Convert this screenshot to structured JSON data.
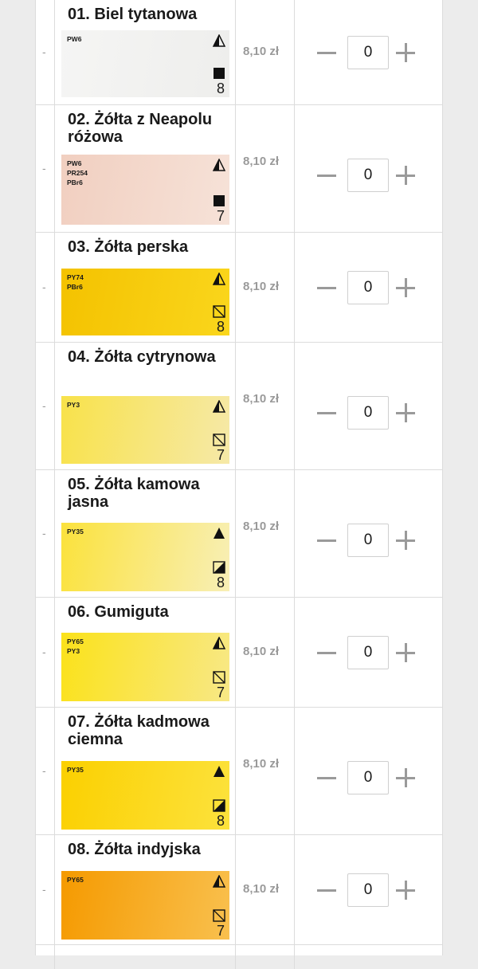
{
  "colors": {
    "price": "#9a9a9a",
    "border": "#dcdcdc",
    "stepper": "#9a9a9a"
  },
  "rows": [
    {
      "dash": "-",
      "name": "01. Biel tytanowa",
      "pigments": [
        "PW6"
      ],
      "transparency": "semi",
      "lightfastness": "full",
      "lightfastness_value": "8",
      "price": "8,10 zł",
      "quantity": "0",
      "swatch_colors": [
        "#f5f5f4",
        "#eeeeec"
      ]
    },
    {
      "dash": "-",
      "name": "02. Żółta z Neapolu różowa",
      "pigments": [
        "PW6",
        "PR254",
        "PBr6"
      ],
      "transparency": "semi",
      "lightfastness": "full",
      "lightfastness_value": "7",
      "price": "8,10 zł",
      "quantity": "0",
      "swatch_colors": [
        "#f1cfc0",
        "#f6e2d8"
      ]
    },
    {
      "dash": "-",
      "name": "03. Żółta perska",
      "pigments": [
        "PY74",
        "PBr6"
      ],
      "transparency": "semi",
      "lightfastness": "hatch",
      "lightfastness_value": "8",
      "price": "8,10 zł",
      "quantity": "0",
      "swatch_colors": [
        "#f4c200",
        "#fad61c"
      ]
    },
    {
      "dash": "-",
      "name": "04. Żółta cytrynowa",
      "pigments": [
        "PY3"
      ],
      "transparency": "semi",
      "lightfastness": "hatch",
      "lightfastness_value": "7",
      "price": "8,10 zł",
      "quantity": "0",
      "swatch_colors": [
        "#f8e24a",
        "#f6e9a8"
      ]
    },
    {
      "dash": "-",
      "name": "05. Żółta kamowa jasna",
      "pigments": [
        "PY35"
      ],
      "transparency": "full",
      "lightfastness": "half",
      "lightfastness_value": "8",
      "price": "8,10 zł",
      "quantity": "0",
      "swatch_colors": [
        "#fbe23c",
        "#f8efb6"
      ]
    },
    {
      "dash": "-",
      "name": "06. Gumiguta",
      "pigments": [
        "PY65",
        "PY3"
      ],
      "transparency": "semi",
      "lightfastness": "hatch",
      "lightfastness_value": "7",
      "price": "8,10 zł",
      "quantity": "0",
      "swatch_colors": [
        "#fbe21a",
        "#f8e886"
      ]
    },
    {
      "dash": "-",
      "name": "07. Żółta kadmowa ciemna",
      "pigments": [
        "PY35"
      ],
      "transparency": "full",
      "lightfastness": "half",
      "lightfastness_value": "8",
      "price": "8,10 zł",
      "quantity": "0",
      "swatch_colors": [
        "#fbd000",
        "#fce23c"
      ]
    },
    {
      "dash": "-",
      "name": "08. Żółta indyjska",
      "pigments": [
        "PY65"
      ],
      "transparency": "semi",
      "lightfastness": "hatch",
      "lightfastness_value": "7",
      "price": "8,10 zł",
      "quantity": "0",
      "swatch_colors": [
        "#f59a00",
        "#f9c04e"
      ]
    },
    {
      "dash": "",
      "name": "",
      "pigments": [],
      "transparency": "",
      "lightfastness": "",
      "lightfastness_value": "",
      "price": "",
      "quantity": "",
      "swatch_colors": []
    }
  ]
}
